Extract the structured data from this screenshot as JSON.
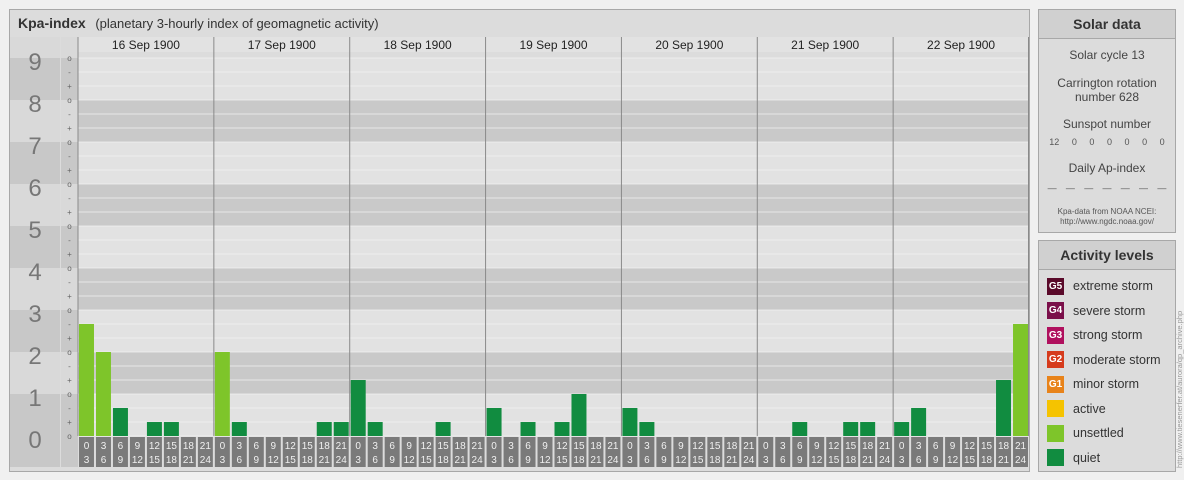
{
  "header": {
    "title": "Kpa-index",
    "subtitle": "(planetary 3-hourly index of geomagnetic activity)"
  },
  "chart_data": {
    "type": "bar",
    "title": "Kpa-index",
    "subtitle": "(planetary 3-hourly index of geomagnetic activity)",
    "ylim": [
      0,
      9
    ],
    "y_ticks": [
      "0",
      "1",
      "2",
      "3",
      "4",
      "5",
      "6",
      "7",
      "8",
      "9"
    ],
    "sub_ticks": [
      "o",
      "+",
      "-"
    ],
    "days": [
      "16 Sep 1900",
      "17 Sep 1900",
      "18 Sep 1900",
      "19 Sep 1900",
      "20 Sep 1900",
      "21 Sep 1900",
      "22 Sep 1900"
    ],
    "interval_starts": [
      "0",
      "3",
      "6",
      "9",
      "12",
      "15",
      "18",
      "21"
    ],
    "interval_ends": [
      "3",
      "6",
      "9",
      "12",
      "15",
      "18",
      "21",
      "24"
    ],
    "values": [
      [
        2.667,
        2.0,
        0.667,
        0,
        0.333,
        0.333,
        0,
        0
      ],
      [
        2.0,
        0.333,
        0,
        0,
        0,
        0,
        0.333,
        0.333
      ],
      [
        1.333,
        0.333,
        0,
        0,
        0,
        0.333,
        0,
        0
      ],
      [
        0.667,
        0,
        0.333,
        0,
        0.333,
        1.0,
        0,
        0
      ],
      [
        0.667,
        0.333,
        0,
        0,
        0,
        0,
        0,
        0
      ],
      [
        0,
        0,
        0.333,
        0,
        0,
        0.333,
        0.333,
        0
      ],
      [
        0.333,
        0.667,
        0,
        0,
        0,
        0,
        1.333,
        2.667
      ]
    ],
    "colors": {
      "quiet": "#118c40",
      "unsettled": "#7ec52a"
    }
  },
  "solar": {
    "title": "Solar data",
    "cycle": "Solar cycle 13",
    "carrington": "Carrington rotation number 628",
    "sunspot_label": "Sunspot number",
    "sunspot_values": [
      "12",
      "0",
      "0",
      "0",
      "0",
      "0",
      "0"
    ],
    "ap_label": "Daily Ap-index",
    "ap_values": [
      "—",
      "—",
      "—",
      "—",
      "—",
      "—",
      "—"
    ],
    "credit_1": "Kpa-data from NOAA NCEI:",
    "credit_2": "http://www.ngdc.noaa.gov/"
  },
  "levels": {
    "title": "Activity levels",
    "items": [
      {
        "code": "G5",
        "label": "extreme storm",
        "color": "#5a0a2a"
      },
      {
        "code": "G4",
        "label": "severe storm",
        "color": "#7a0f4a"
      },
      {
        "code": "G3",
        "label": "strong storm",
        "color": "#b0105e"
      },
      {
        "code": "G2",
        "label": "moderate storm",
        "color": "#d63b1c"
      },
      {
        "code": "G1",
        "label": "minor storm",
        "color": "#e8831a"
      },
      {
        "code": "",
        "label": "active",
        "color": "#f5c300"
      },
      {
        "code": "",
        "label": "unsettled",
        "color": "#7ec52a"
      },
      {
        "code": "",
        "label": "quiet",
        "color": "#118c40"
      }
    ]
  },
  "side_url": "http://www.tiesenerfer.at/aurora/qp_archive.php"
}
